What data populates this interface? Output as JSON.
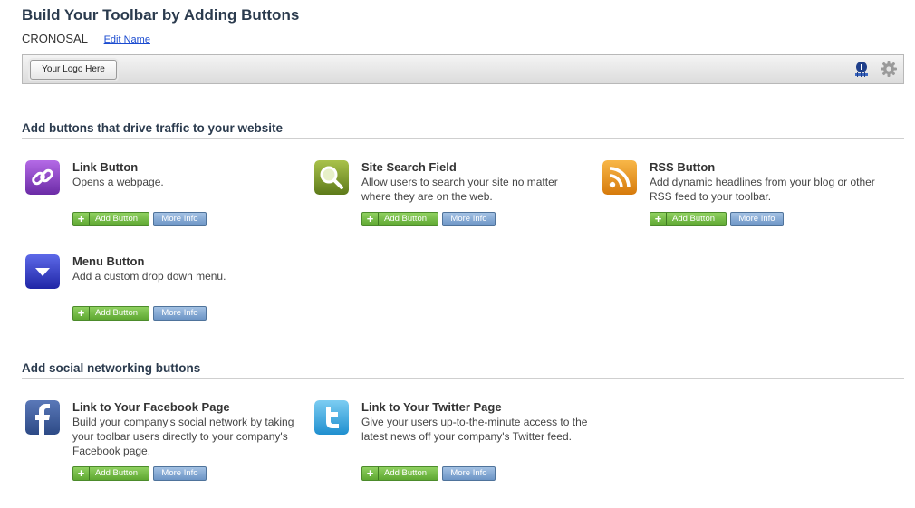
{
  "page": {
    "title": "Build Your Toolbar by Adding Buttons",
    "toolbar_name": "CRONOSAL",
    "edit_name_label": "Edit Name"
  },
  "toolbar_preview": {
    "logo_label": "Your Logo Here",
    "icons": [
      "info-icon",
      "gear-icon"
    ]
  },
  "sections": [
    {
      "title": "Add buttons that drive traffic to your website",
      "items": [
        {
          "title": "Link Button",
          "desc": "Opens a webpage.",
          "icon": "link-icon",
          "color": "#8a3fc4"
        },
        {
          "title": "Site Search Field",
          "desc": "Allow users to search your site no matter where they are on the web.",
          "icon": "search-icon",
          "color": "#7f9a2a"
        },
        {
          "title": "RSS Button",
          "desc": "Add dynamic headlines from your blog or other RSS feed to your toolbar.",
          "icon": "rss-icon",
          "color": "#e8951d"
        },
        {
          "title": "Menu Button",
          "desc": "Add a custom drop down menu.",
          "icon": "menu-dropdown-icon",
          "color": "#3440c8"
        }
      ]
    },
    {
      "title": "Add social networking buttons",
      "items": [
        {
          "title": "Link to Your Facebook Page",
          "desc": "Build your company's social network by taking your toolbar users directly to your company's Facebook page.",
          "icon": "facebook-icon",
          "color": "#3b5a9a"
        },
        {
          "title": "Link to Your Twitter Page",
          "desc": "Give your users up-to-the-minute access to the latest news off your company's Twitter feed.",
          "icon": "twitter-icon",
          "color": "#3aa7de"
        }
      ]
    }
  ],
  "buttons": {
    "add_label": "Add Button",
    "more_info_label": "More Info",
    "plus_glyph": "+"
  }
}
